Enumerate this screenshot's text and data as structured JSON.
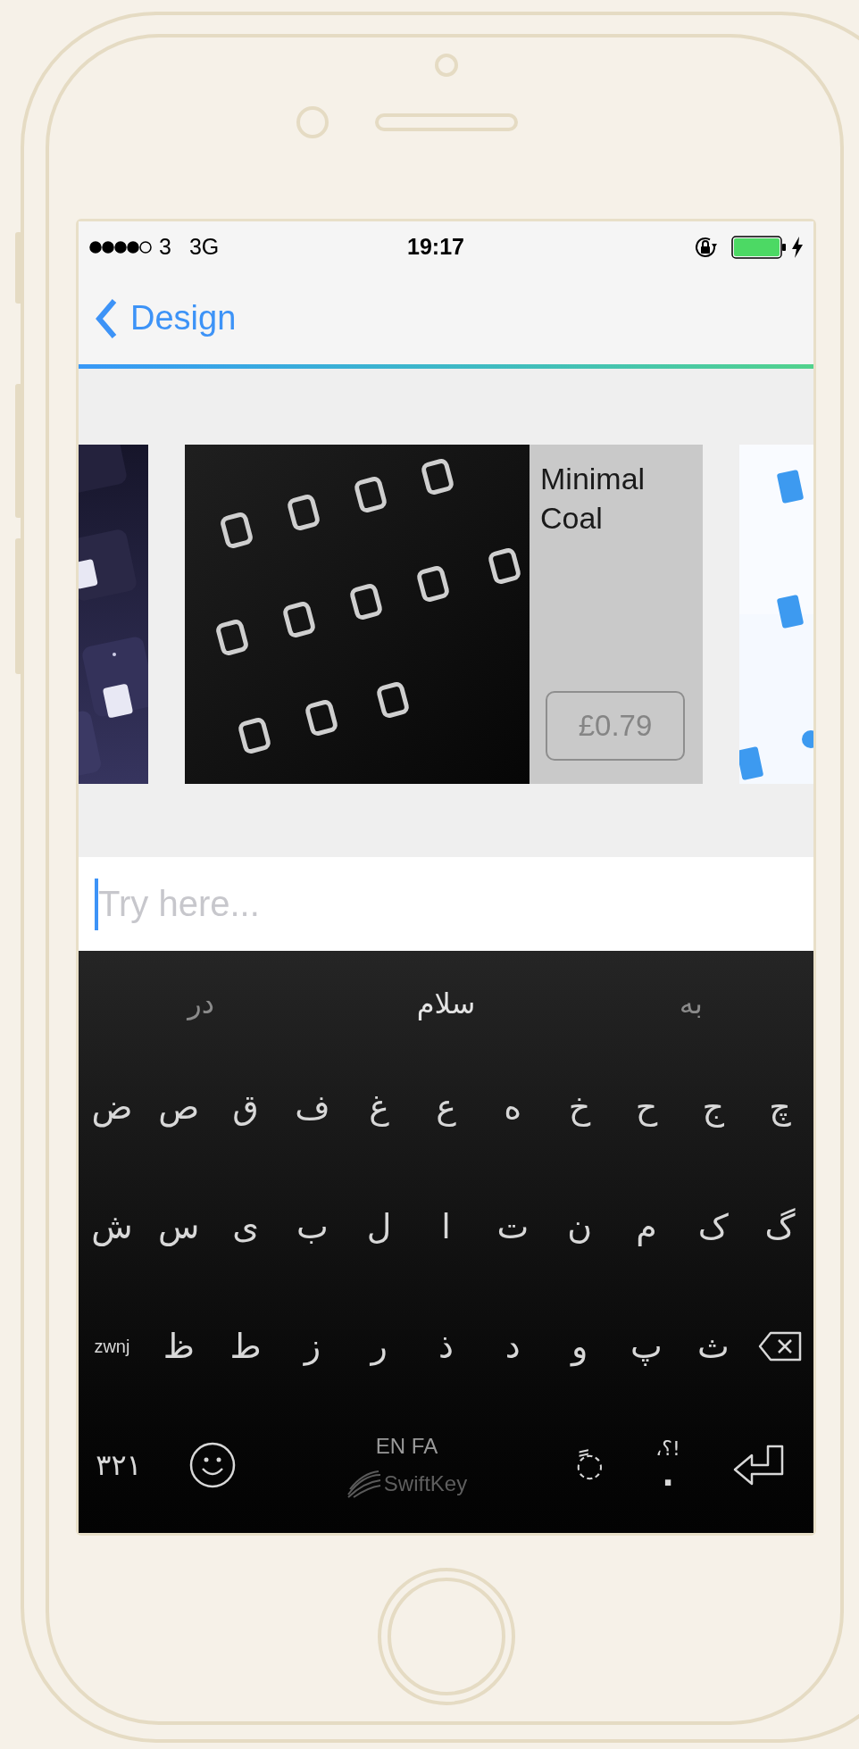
{
  "status_bar": {
    "carrier": "3",
    "network": "3G",
    "time": "19:17"
  },
  "nav": {
    "back_label": "Design"
  },
  "theme_cards": [
    {
      "kind": "preview"
    },
    {
      "kind": "product",
      "name": "Minimal Coal",
      "price": "£0.79"
    },
    {
      "kind": "preview"
    }
  ],
  "text_field": {
    "placeholder": "Try here..."
  },
  "keyboard": {
    "suggestions": [
      {
        "text": "به",
        "selected": false
      },
      {
        "text": "سلام",
        "selected": true
      },
      {
        "text": "در",
        "selected": false
      }
    ],
    "rows": [
      [
        "ض",
        "ص",
        "ق",
        "ف",
        "غ",
        "ع",
        "ه",
        "خ",
        "ح",
        "ج",
        "چ"
      ],
      [
        "ش",
        "س",
        "ی",
        "ب",
        "ل",
        "ا",
        "ت",
        "ن",
        "م",
        "ک",
        "گ"
      ],
      [
        "zwnj",
        "ظ",
        "ط",
        "ز",
        "ر",
        "ذ",
        "د",
        "و",
        "پ",
        "ث"
      ]
    ],
    "numbers_key": "۳۲۱",
    "languages": "EN FA",
    "brand": "SwiftKey",
    "diacritic_key": "◌ً",
    "punctuation_top": "،؟!",
    "punctuation_key": "."
  }
}
